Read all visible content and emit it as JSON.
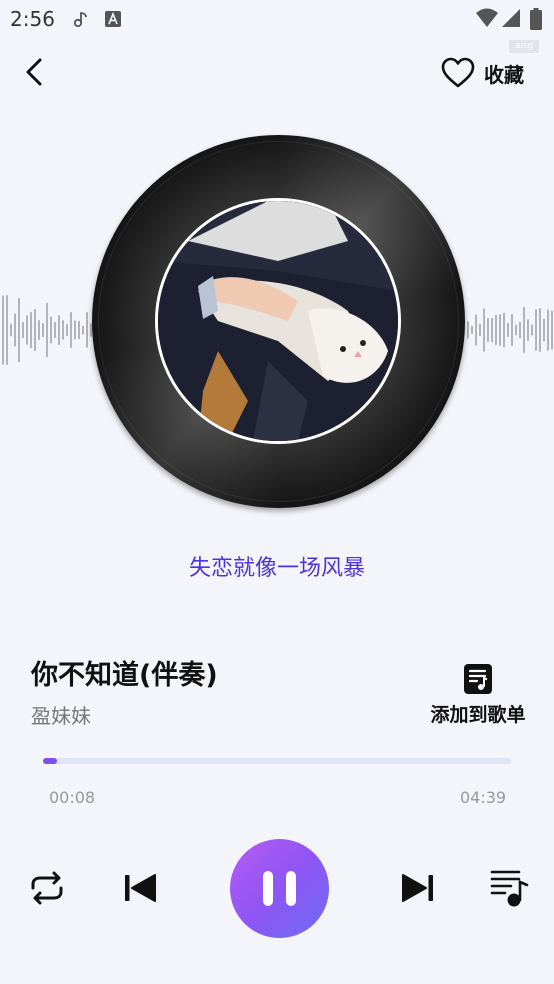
{
  "status_bar": {
    "time": "2:56"
  },
  "watermark": "aisg",
  "nav": {
    "favorite_label": "收藏"
  },
  "lyric": "失恋就像一场风暴",
  "song": {
    "title": "你不知道(伴奏)",
    "artist": "盈妹妹"
  },
  "add_to_playlist": {
    "label": "添加到歌单"
  },
  "progress": {
    "current": "00:08",
    "total": "04:39",
    "fraction": 0.029
  },
  "colors": {
    "accent": "#7b52f0",
    "lyric": "#4c33e0",
    "background": "#f4f5fa"
  },
  "icons": [
    "back-arrow-icon",
    "heart-icon",
    "playlist-add-icon",
    "repeat-icon",
    "previous-icon",
    "pause-icon",
    "next-icon",
    "queue-icon"
  ]
}
